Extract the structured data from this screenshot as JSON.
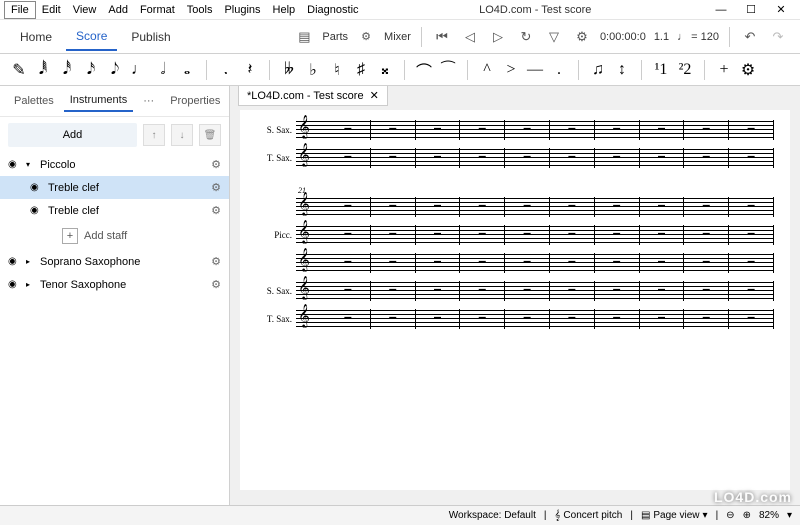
{
  "window": {
    "title": "LO4D.com - Test score",
    "menus": [
      "File",
      "Edit",
      "View",
      "Add",
      "Format",
      "Tools",
      "Plugins",
      "Help",
      "Diagnostic"
    ]
  },
  "toolbar": {
    "tabs": {
      "home": "Home",
      "score": "Score",
      "publish": "Publish"
    },
    "parts": "Parts",
    "mixer": "Mixer",
    "time": "0:00:00:0",
    "position": "1.1",
    "tempo_marker": "♩ = 120"
  },
  "sidebar": {
    "tabs": {
      "palettes": "Palettes",
      "instruments": "Instruments",
      "properties": "Properties"
    },
    "add": "Add",
    "add_staff": "Add staff",
    "tree": {
      "piccolo": "Piccolo",
      "treble1": "Treble clef",
      "treble2": "Treble clef",
      "soprano_sax": "Soprano Saxophone",
      "tenor_sax": "Tenor Saxophone"
    }
  },
  "doc": {
    "tab_label": "*LO4D.com - Test score"
  },
  "score": {
    "system1": {
      "labels": [
        "S. Sax.",
        "T. Sax."
      ]
    },
    "system2": {
      "measure": "21",
      "labels": [
        "",
        "Picc.",
        "",
        "S. Sax.",
        "T. Sax."
      ]
    }
  },
  "statusbar": {
    "workspace": "Workspace: Default",
    "concert_pitch": "Concert pitch",
    "page_view": "Page view",
    "zoom": "82%"
  },
  "watermark": "LO4D.com"
}
